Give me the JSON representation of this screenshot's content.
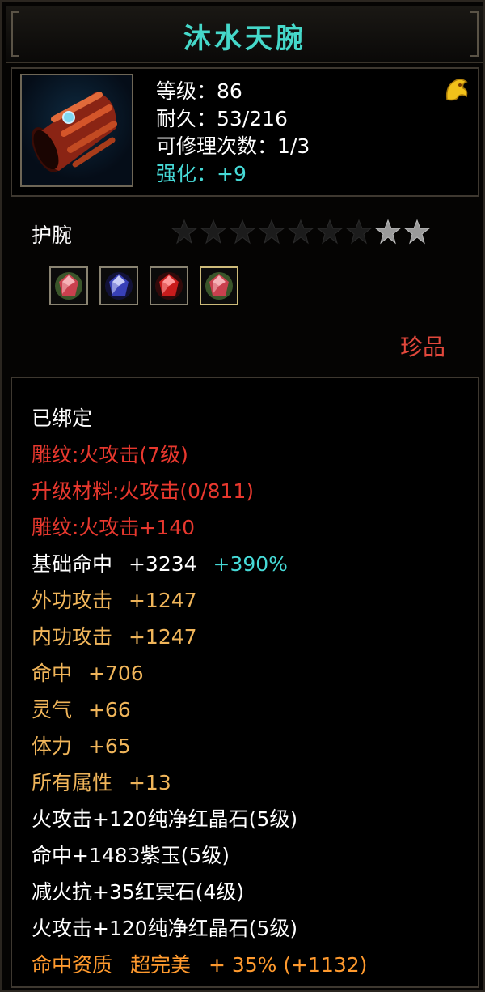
{
  "item": {
    "name": "沐水天腕",
    "level": "等级：86",
    "durability": "耐久：53/216",
    "repairs": "可修理次数：1/3",
    "enhance": "强化：+9",
    "type": "护腕",
    "rarity": "珍品",
    "stars": {
      "max": 9,
      "lit": 2
    },
    "gems": [
      "pink-gem-icon",
      "blue-sapphire-icon",
      "red-ruby-icon",
      "pink-gem-icon"
    ],
    "selected_gem": 4
  },
  "attributes": {
    "bound": "已绑定",
    "engrave": "雕纹:火攻击(7级)",
    "upgrade_material": "升级材料:火攻击(0/811)",
    "engrave_bonus": "雕纹:火攻击+140",
    "base_hit_label": "基础命中",
    "base_hit_value": "+3234",
    "base_hit_pct": "+390%",
    "ext_attack_label": "外功攻击",
    "ext_attack_value": "+1247",
    "int_attack_label": "内功攻击",
    "int_attack_value": "+1247",
    "hit_label": "命中",
    "hit_value": "+706",
    "spirit_label": "灵气",
    "spirit_value": "+66",
    "stamina_label": "体力",
    "stamina_value": "+65",
    "all_attr_label": "所有属性",
    "all_attr_value": "+13",
    "gem1": "火攻击+120纯净红晶石(5级)",
    "gem2": "命中+1483紫玉(5级)",
    "gem3": "减火抗+35红冥石(4级)",
    "gem4": "火攻击+120纯净红晶石(5级)",
    "quality_label": "命中资质",
    "quality_grade": "超完美",
    "quality_value": "+ 35% (+1132)"
  },
  "colors": {
    "title": "#45d8c9",
    "normal": "#ffffff",
    "engrave": "#e8382e",
    "stat": "#f0b55a",
    "quality": "#ff9a2e",
    "bonus": "#46d9d6",
    "rarity": "#e2483c"
  }
}
